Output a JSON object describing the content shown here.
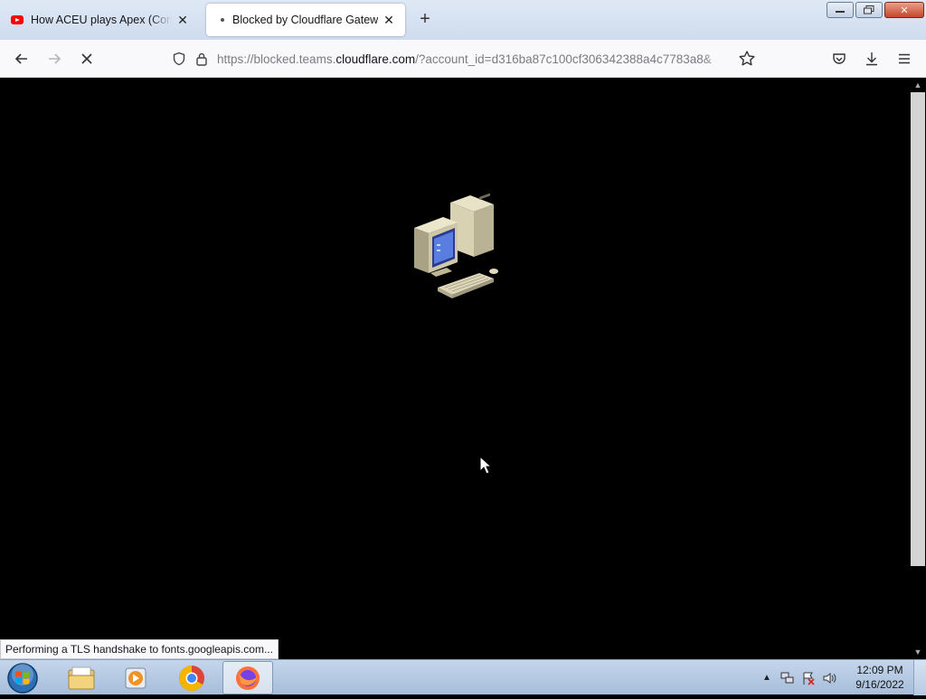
{
  "browser": {
    "tabs": [
      {
        "title": "How ACEU plays Apex (Compilation)",
        "icon": "youtube-icon",
        "active": false
      },
      {
        "title": "Blocked by Cloudflare Gateway",
        "icon": "loading-dot-icon",
        "active": true
      }
    ],
    "url": {
      "prefix": "https://blocked.teams.",
      "host": "cloudflare.com",
      "suffix": "/?account_id=d316ba87c100cf306342388a4c7783a8&"
    },
    "status_text": "Performing a TLS handshake to fonts.googleapis.com..."
  },
  "taskbar": {
    "clock_time": "12:09 PM",
    "clock_date": "9/16/2022"
  },
  "colors": {
    "page_background": "#000000",
    "tab_strip": "#cfdcee",
    "taskbar": "#b3c7e1"
  }
}
